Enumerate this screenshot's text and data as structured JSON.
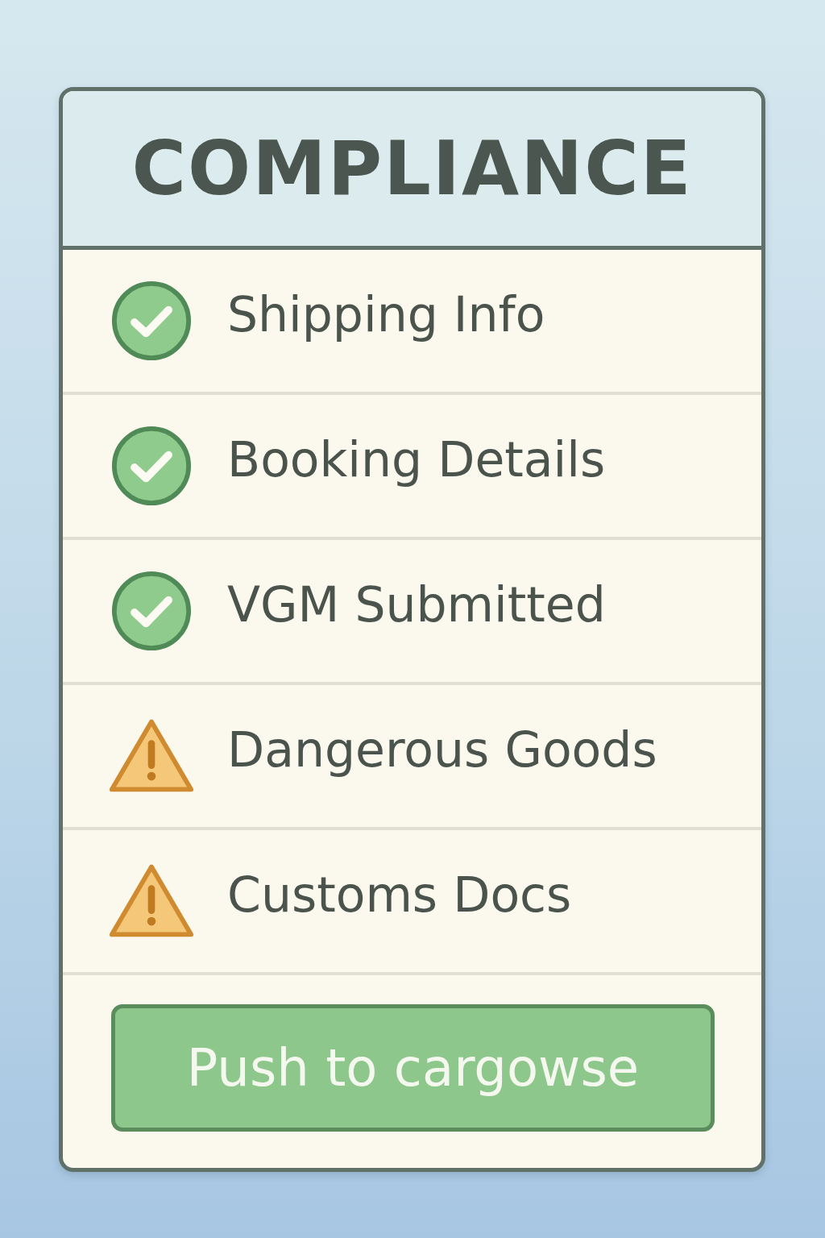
{
  "card": {
    "title": "COMPLIANCE",
    "items": [
      {
        "label": "Shipping Info",
        "kind": "ok"
      },
      {
        "label": "Booking Details",
        "kind": "ok"
      },
      {
        "label": "VGM Submitted",
        "kind": "ok"
      },
      {
        "label": "Dangerous Goods",
        "kind": "warning"
      },
      {
        "label": "Customs Docs",
        "kind": "warning"
      }
    ],
    "button": "Push to cargowse"
  }
}
